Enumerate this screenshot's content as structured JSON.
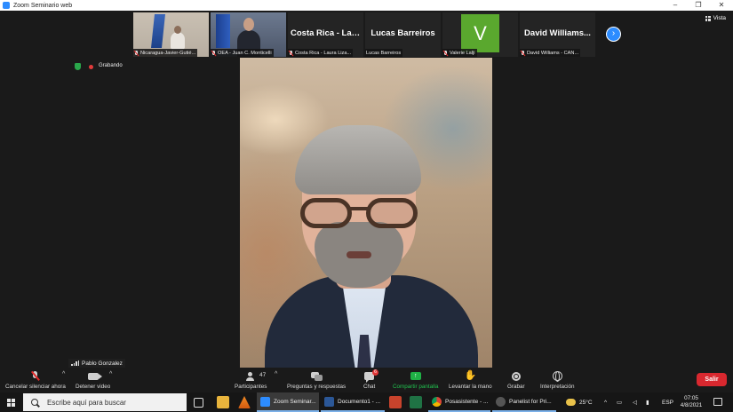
{
  "window": {
    "title": "Zoom Seminario web",
    "controls": [
      "–",
      "❐",
      "✕"
    ]
  },
  "view_button": {
    "label": "Vista"
  },
  "participants_strip": [
    {
      "kind": "video",
      "name": "Nicaragua-Javier-Gutié..."
    },
    {
      "kind": "video",
      "name": "OEA - Juan C. Monticelli"
    },
    {
      "kind": "name",
      "big_name": "Costa Rica - Lau...",
      "name": "Costa Rica - Laura Liza..."
    },
    {
      "kind": "name",
      "big_name": "Lucas Barreiros",
      "name": "Lucas Barreiros"
    },
    {
      "kind": "avatar",
      "letter": "V",
      "name": "Valerie Lalji"
    },
    {
      "kind": "name",
      "big_name": "David Williams...",
      "name": "David Williams - CAN..."
    }
  ],
  "next_page_icon": "›",
  "recording": {
    "label": "Grabando"
  },
  "speaker": {
    "name": "Pablo Gonzalez"
  },
  "controls": {
    "mute": {
      "label": "Cancelar silenciar ahora"
    },
    "video": {
      "label": "Detener video"
    },
    "participants": {
      "label": "Participantes",
      "count": "47"
    },
    "qa": {
      "label": "Preguntas y respuestas"
    },
    "chat": {
      "label": "Chat",
      "badge": "6"
    },
    "share": {
      "label": "Compartir pantalla"
    },
    "raise_hand": {
      "label": "Levantar la mano"
    },
    "record": {
      "label": "Grabar"
    },
    "interpretation": {
      "label": "Interpretación"
    },
    "leave": {
      "label": "Salir"
    },
    "caret": "^"
  },
  "taskbar": {
    "search_placeholder": "Escribe aquí para buscar",
    "apps": [
      {
        "label": "Zoom Seminar...",
        "color": "#2d8cff"
      },
      {
        "label": "Documento1 - ...",
        "color": "#2b5797"
      },
      {
        "label": "Posasistente - ...",
        "color": "#e8a33c"
      },
      {
        "label": "Panelist for Pri...",
        "color": "#3c3c3c"
      }
    ],
    "weather": "25°C",
    "language": "ESP",
    "time": "07:05",
    "date": "4/8/2021"
  },
  "colors": {
    "accent": "#2d8cff",
    "share_green": "#21c24f",
    "leave_red": "#d9282f",
    "avatar_green": "#5aa82e"
  }
}
